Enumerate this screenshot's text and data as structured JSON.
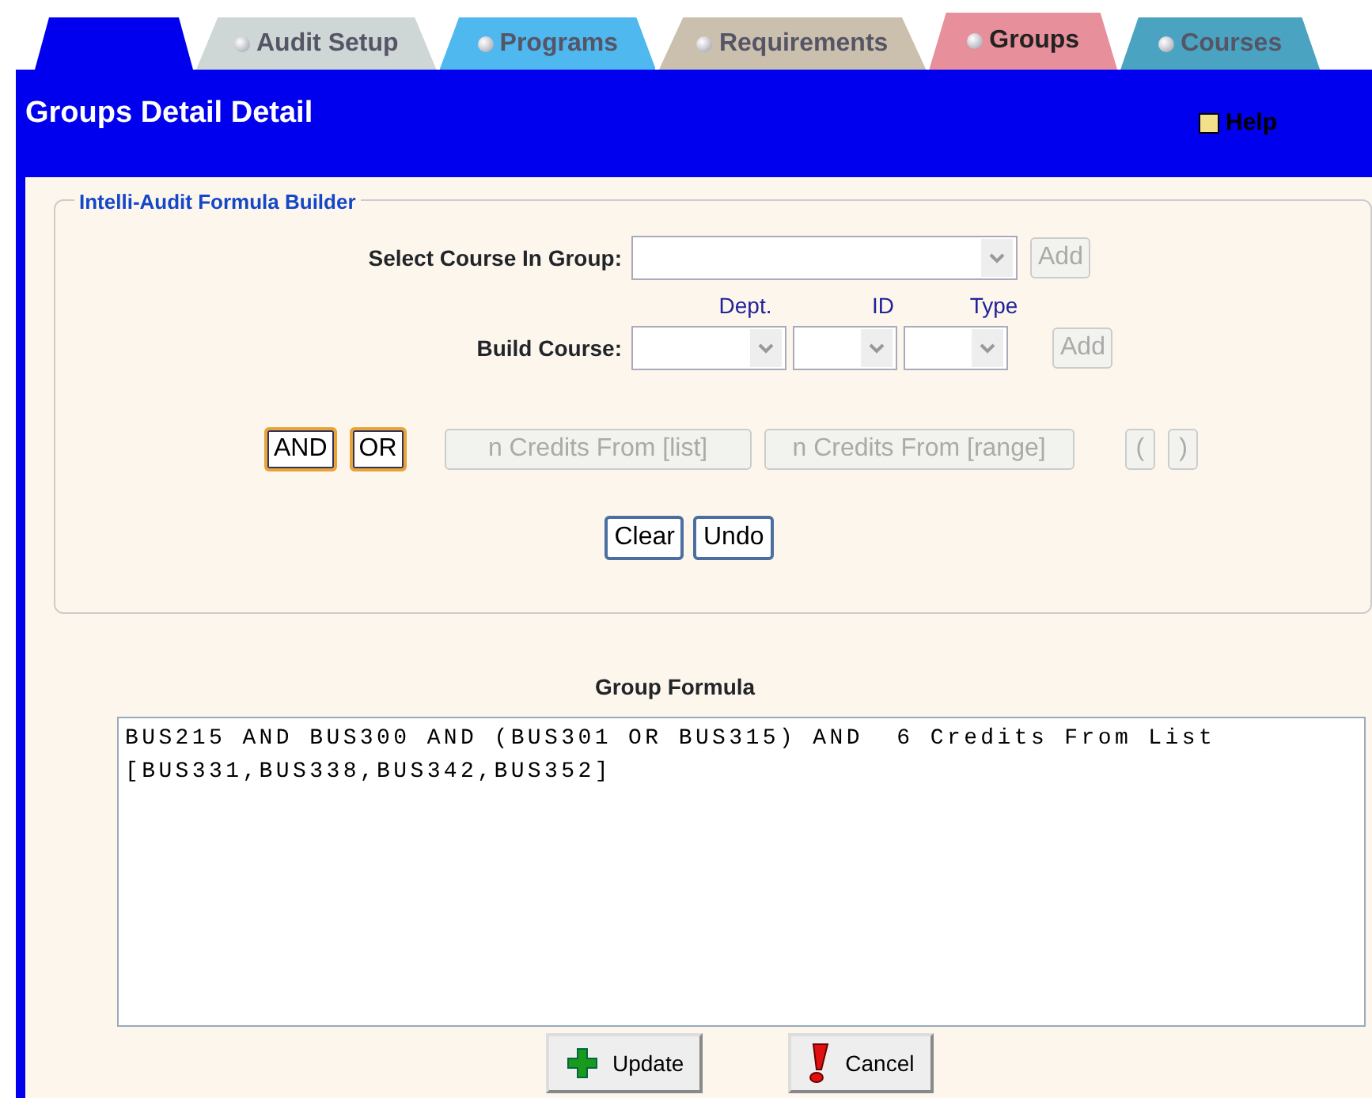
{
  "tabs": [
    {
      "color": "#0000ee",
      "selected": false
    },
    {
      "label": "Audit Setup",
      "color": "#cfd6d6",
      "selected": false
    },
    {
      "label": "Programs",
      "color": "#4fb8ee",
      "selected": false
    },
    {
      "label": "Requirements",
      "color": "#cbbfae",
      "selected": false
    },
    {
      "label": "Groups",
      "color": "#e88f9c",
      "selected": true
    },
    {
      "label": "Courses",
      "color": "#4aa3c0",
      "selected": false
    }
  ],
  "header": {
    "title": "Groups Detail Detail",
    "help": "Help"
  },
  "builder": {
    "legend": "Intelli-Audit Formula Builder",
    "select_label": "Select Course In Group:",
    "select_add": {
      "label": "Add",
      "disabled": true
    },
    "column_labels": [
      "Dept.",
      "ID",
      "Type"
    ],
    "build_label": "Build Course:",
    "build_add": {
      "label": "Add",
      "disabled": true
    },
    "operators": [
      {
        "label": "AND",
        "disabled": false
      },
      {
        "label": "OR",
        "disabled": false
      },
      {
        "label": "n Credits From [list]",
        "disabled": true
      },
      {
        "label": "n Credits From [range]",
        "disabled": true
      },
      {
        "label": "(",
        "disabled": true
      },
      {
        "label": ")",
        "disabled": true
      }
    ],
    "actions": [
      {
        "label": "Clear",
        "disabled": false
      },
      {
        "label": "Undo",
        "disabled": false
      }
    ]
  },
  "formula": {
    "title": "Group Formula",
    "value": "BUS215 AND BUS300 AND (BUS301 OR BUS315) AND  6 Credits From List [BUS331,BUS338,BUS342,BUS352]"
  },
  "buttons": [
    {
      "kind": "update",
      "label": "Update"
    },
    {
      "kind": "cancel",
      "label": "Cancel"
    }
  ]
}
